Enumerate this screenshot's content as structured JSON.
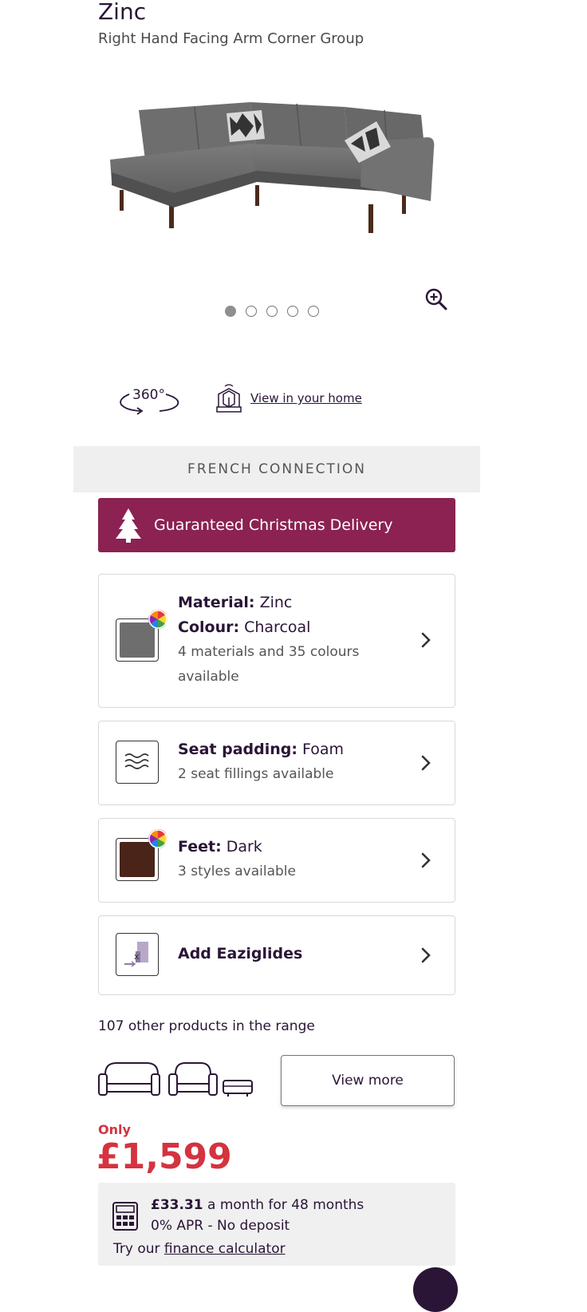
{
  "product": {
    "title": "Zinc",
    "subtitle": "Right Hand Facing Arm Corner Group"
  },
  "gallery": {
    "image_icon": "corner-sofa-image",
    "zoom_icon": "zoom-in-icon",
    "dots_total": 5,
    "active_dot": 1
  },
  "tools": {
    "spin_label": "360°",
    "view_home_label": "View in your home"
  },
  "brand": {
    "label": "FRENCH CONNECTION"
  },
  "delivery": {
    "label": "Guaranteed Christmas Delivery",
    "color": "#8b2252"
  },
  "options": {
    "material": {
      "label": "Material:",
      "value": "Zinc",
      "colour_label": "Colour:",
      "colour_value": "Charcoal",
      "note": "4 materials and 35 colours",
      "note2": "available",
      "swatch_color": "#6e6e6e"
    },
    "padding": {
      "label": "Seat padding:",
      "value": "Foam",
      "note": "2 seat fillings available"
    },
    "feet": {
      "label": "Feet:",
      "value": "Dark",
      "note": "3 styles available",
      "swatch_color": "#4a2418"
    },
    "glides": {
      "label": "Add Eaziglides"
    }
  },
  "range": {
    "text": "107 other products in the range",
    "button": "View more"
  },
  "pricing": {
    "only_label": "Only",
    "price": "£1,599",
    "price_color": "#d4333f"
  },
  "finance": {
    "monthly_amount": "£33.31",
    "monthly_text": "a month for 48 months",
    "apr_text": "0% APR - No deposit",
    "try_text": "Try our",
    "calculator_link": "finance calculator"
  }
}
